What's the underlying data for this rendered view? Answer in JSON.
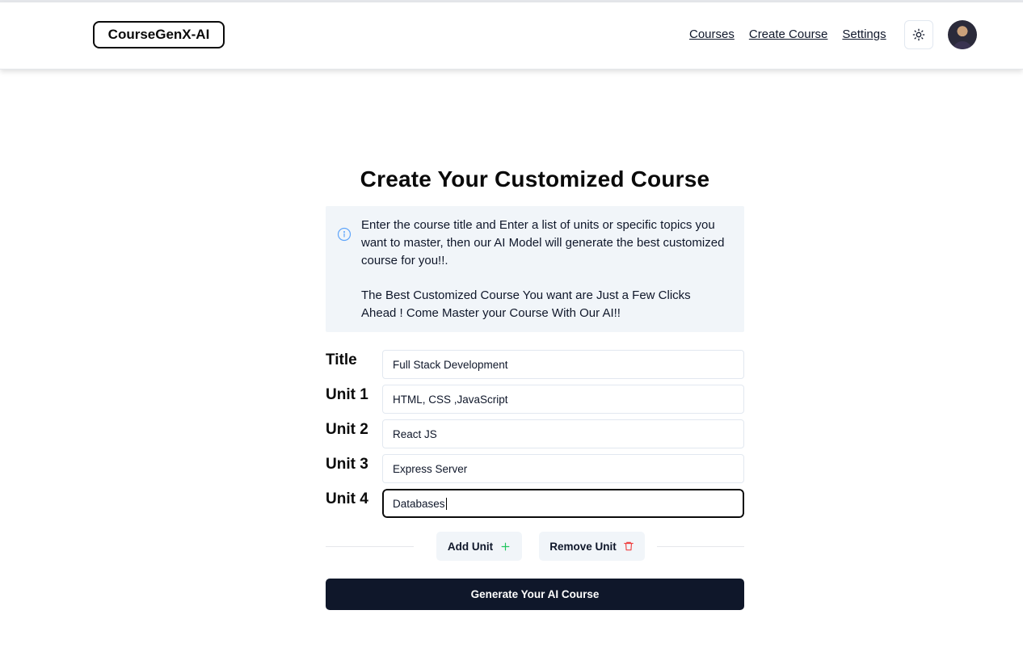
{
  "app": {
    "logo": "CourseGenX-AI"
  },
  "nav": {
    "items": [
      "Courses",
      "Create Course",
      "Settings"
    ]
  },
  "page": {
    "title": "Create Your Customized Course"
  },
  "info": {
    "paragraph1": "Enter the course title and Enter a list of units or specific topics you want to master, then our AI Model will generate the best customized course for you!!.",
    "paragraph2": "The Best Customized Course You want are Just a Few Clicks Ahead ! Come Master your Course With Our AI!!"
  },
  "form": {
    "rows": [
      {
        "label": "Title",
        "value": "Full Stack Development"
      },
      {
        "label": "Unit 1",
        "value": "HTML, CSS ,JavaScript"
      },
      {
        "label": "Unit 2",
        "value": "React JS"
      },
      {
        "label": "Unit 3",
        "value": "Express Server"
      },
      {
        "label": "Unit 4",
        "value": "Databases"
      }
    ],
    "add_unit_label": "Add Unit",
    "remove_unit_label": "Remove Unit",
    "generate_label": "Generate Your AI Course"
  },
  "colors": {
    "primary": "#0f172a",
    "info_bg": "#f1f5f9",
    "add_icon": "#22c55e",
    "remove_icon": "#ef4444",
    "info_icon": "#60a5fa"
  },
  "icons": {
    "theme": "sun-icon",
    "info": "info-icon",
    "add": "plus-icon",
    "remove": "trash-icon"
  }
}
